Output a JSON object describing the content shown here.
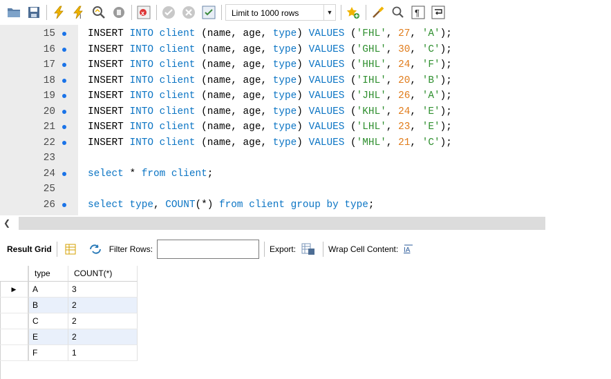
{
  "toolbar": {
    "limit_label": "Limit to 1000 rows",
    "icons": [
      "open-folder-icon",
      "save-icon",
      "execute-icon",
      "execute-current-icon",
      "explain-icon",
      "stop-icon",
      "toggle-error-icon",
      "commit-icon",
      "rollback-icon",
      "autocommit-icon",
      "add-snippet-icon",
      "beautify-icon",
      "find-icon",
      "invisible-chars-icon",
      "wrap-lines-icon"
    ]
  },
  "editor": {
    "lines": [
      {
        "num": "15",
        "dot": true,
        "tokens": [
          [
            "kw",
            "INSERT "
          ],
          [
            "kw-blue",
            "INTO client "
          ],
          [
            "kw",
            "(name, age, "
          ],
          [
            "kw-blue",
            "type"
          ],
          [
            "kw",
            ") "
          ],
          [
            "kw-blue",
            "VALUES "
          ],
          [
            "kw",
            "("
          ],
          [
            "str",
            "'FHL'"
          ],
          [
            "kw",
            ", "
          ],
          [
            "num",
            "27"
          ],
          [
            "kw",
            ", "
          ],
          [
            "str",
            "'A'"
          ],
          [
            "kw",
            ");"
          ]
        ]
      },
      {
        "num": "16",
        "dot": true,
        "tokens": [
          [
            "kw",
            "INSERT "
          ],
          [
            "kw-blue",
            "INTO client "
          ],
          [
            "kw",
            "(name, age, "
          ],
          [
            "kw-blue",
            "type"
          ],
          [
            "kw",
            ") "
          ],
          [
            "kw-blue",
            "VALUES "
          ],
          [
            "kw",
            "("
          ],
          [
            "str",
            "'GHL'"
          ],
          [
            "kw",
            ", "
          ],
          [
            "num",
            "30"
          ],
          [
            "kw",
            ", "
          ],
          [
            "str",
            "'C'"
          ],
          [
            "kw",
            ");"
          ]
        ]
      },
      {
        "num": "17",
        "dot": true,
        "tokens": [
          [
            "kw",
            "INSERT "
          ],
          [
            "kw-blue",
            "INTO client "
          ],
          [
            "kw",
            "(name, age, "
          ],
          [
            "kw-blue",
            "type"
          ],
          [
            "kw",
            ") "
          ],
          [
            "kw-blue",
            "VALUES "
          ],
          [
            "kw",
            "("
          ],
          [
            "str",
            "'HHL'"
          ],
          [
            "kw",
            ", "
          ],
          [
            "num",
            "24"
          ],
          [
            "kw",
            ", "
          ],
          [
            "str",
            "'F'"
          ],
          [
            "kw",
            ");"
          ]
        ]
      },
      {
        "num": "18",
        "dot": true,
        "tokens": [
          [
            "kw",
            "INSERT "
          ],
          [
            "kw-blue",
            "INTO client "
          ],
          [
            "kw",
            "(name, age, "
          ],
          [
            "kw-blue",
            "type"
          ],
          [
            "kw",
            ") "
          ],
          [
            "kw-blue",
            "VALUES "
          ],
          [
            "kw",
            "("
          ],
          [
            "str",
            "'IHL'"
          ],
          [
            "kw",
            ", "
          ],
          [
            "num",
            "20"
          ],
          [
            "kw",
            ", "
          ],
          [
            "str",
            "'B'"
          ],
          [
            "kw",
            ");"
          ]
        ]
      },
      {
        "num": "19",
        "dot": true,
        "tokens": [
          [
            "kw",
            "INSERT "
          ],
          [
            "kw-blue",
            "INTO client "
          ],
          [
            "kw",
            "(name, age, "
          ],
          [
            "kw-blue",
            "type"
          ],
          [
            "kw",
            ") "
          ],
          [
            "kw-blue",
            "VALUES "
          ],
          [
            "kw",
            "("
          ],
          [
            "str",
            "'JHL'"
          ],
          [
            "kw",
            ", "
          ],
          [
            "num",
            "26"
          ],
          [
            "kw",
            ", "
          ],
          [
            "str",
            "'A'"
          ],
          [
            "kw",
            ");"
          ]
        ]
      },
      {
        "num": "20",
        "dot": true,
        "tokens": [
          [
            "kw",
            "INSERT "
          ],
          [
            "kw-blue",
            "INTO client "
          ],
          [
            "kw",
            "(name, age, "
          ],
          [
            "kw-blue",
            "type"
          ],
          [
            "kw",
            ") "
          ],
          [
            "kw-blue",
            "VALUES "
          ],
          [
            "kw",
            "("
          ],
          [
            "str",
            "'KHL'"
          ],
          [
            "kw",
            ", "
          ],
          [
            "num",
            "24"
          ],
          [
            "kw",
            ", "
          ],
          [
            "str",
            "'E'"
          ],
          [
            "kw",
            ");"
          ]
        ]
      },
      {
        "num": "21",
        "dot": true,
        "tokens": [
          [
            "kw",
            "INSERT "
          ],
          [
            "kw-blue",
            "INTO client "
          ],
          [
            "kw",
            "(name, age, "
          ],
          [
            "kw-blue",
            "type"
          ],
          [
            "kw",
            ") "
          ],
          [
            "kw-blue",
            "VALUES "
          ],
          [
            "kw",
            "("
          ],
          [
            "str",
            "'LHL'"
          ],
          [
            "kw",
            ", "
          ],
          [
            "num",
            "23"
          ],
          [
            "kw",
            ", "
          ],
          [
            "str",
            "'E'"
          ],
          [
            "kw",
            ");"
          ]
        ]
      },
      {
        "num": "22",
        "dot": true,
        "tokens": [
          [
            "kw",
            "INSERT "
          ],
          [
            "kw-blue",
            "INTO client "
          ],
          [
            "kw",
            "(name, age, "
          ],
          [
            "kw-blue",
            "type"
          ],
          [
            "kw",
            ") "
          ],
          [
            "kw-blue",
            "VALUES "
          ],
          [
            "kw",
            "("
          ],
          [
            "str",
            "'MHL'"
          ],
          [
            "kw",
            ", "
          ],
          [
            "num",
            "21"
          ],
          [
            "kw",
            ", "
          ],
          [
            "str",
            "'C'"
          ],
          [
            "kw",
            ");"
          ]
        ]
      },
      {
        "num": "23",
        "dot": false,
        "tokens": []
      },
      {
        "num": "24",
        "dot": true,
        "tokens": [
          [
            "kw-blue",
            "select "
          ],
          [
            "kw",
            "* "
          ],
          [
            "kw-blue",
            "from client"
          ],
          [
            "kw",
            ";"
          ]
        ]
      },
      {
        "num": "25",
        "dot": false,
        "tokens": []
      },
      {
        "num": "26",
        "dot": true,
        "tokens": [
          [
            "kw-blue",
            "select type"
          ],
          [
            "kw",
            ", "
          ],
          [
            "kw-blue",
            "COUNT"
          ],
          [
            "kw",
            "(*) "
          ],
          [
            "kw-blue",
            "from client group by type"
          ],
          [
            "kw",
            ";"
          ]
        ]
      }
    ]
  },
  "result_bar": {
    "result_grid_label": "Result Grid",
    "filter_label": "Filter Rows:",
    "filter_value": "",
    "export_label": "Export:",
    "wrap_label": "Wrap Cell Content:"
  },
  "grid": {
    "headers": [
      "type",
      "COUNT(*)"
    ],
    "rows": [
      {
        "type": "A",
        "count": "3",
        "current": true
      },
      {
        "type": "B",
        "count": "2",
        "current": false
      },
      {
        "type": "C",
        "count": "2",
        "current": false
      },
      {
        "type": "E",
        "count": "2",
        "current": false
      },
      {
        "type": "F",
        "count": "1",
        "current": false
      }
    ]
  }
}
